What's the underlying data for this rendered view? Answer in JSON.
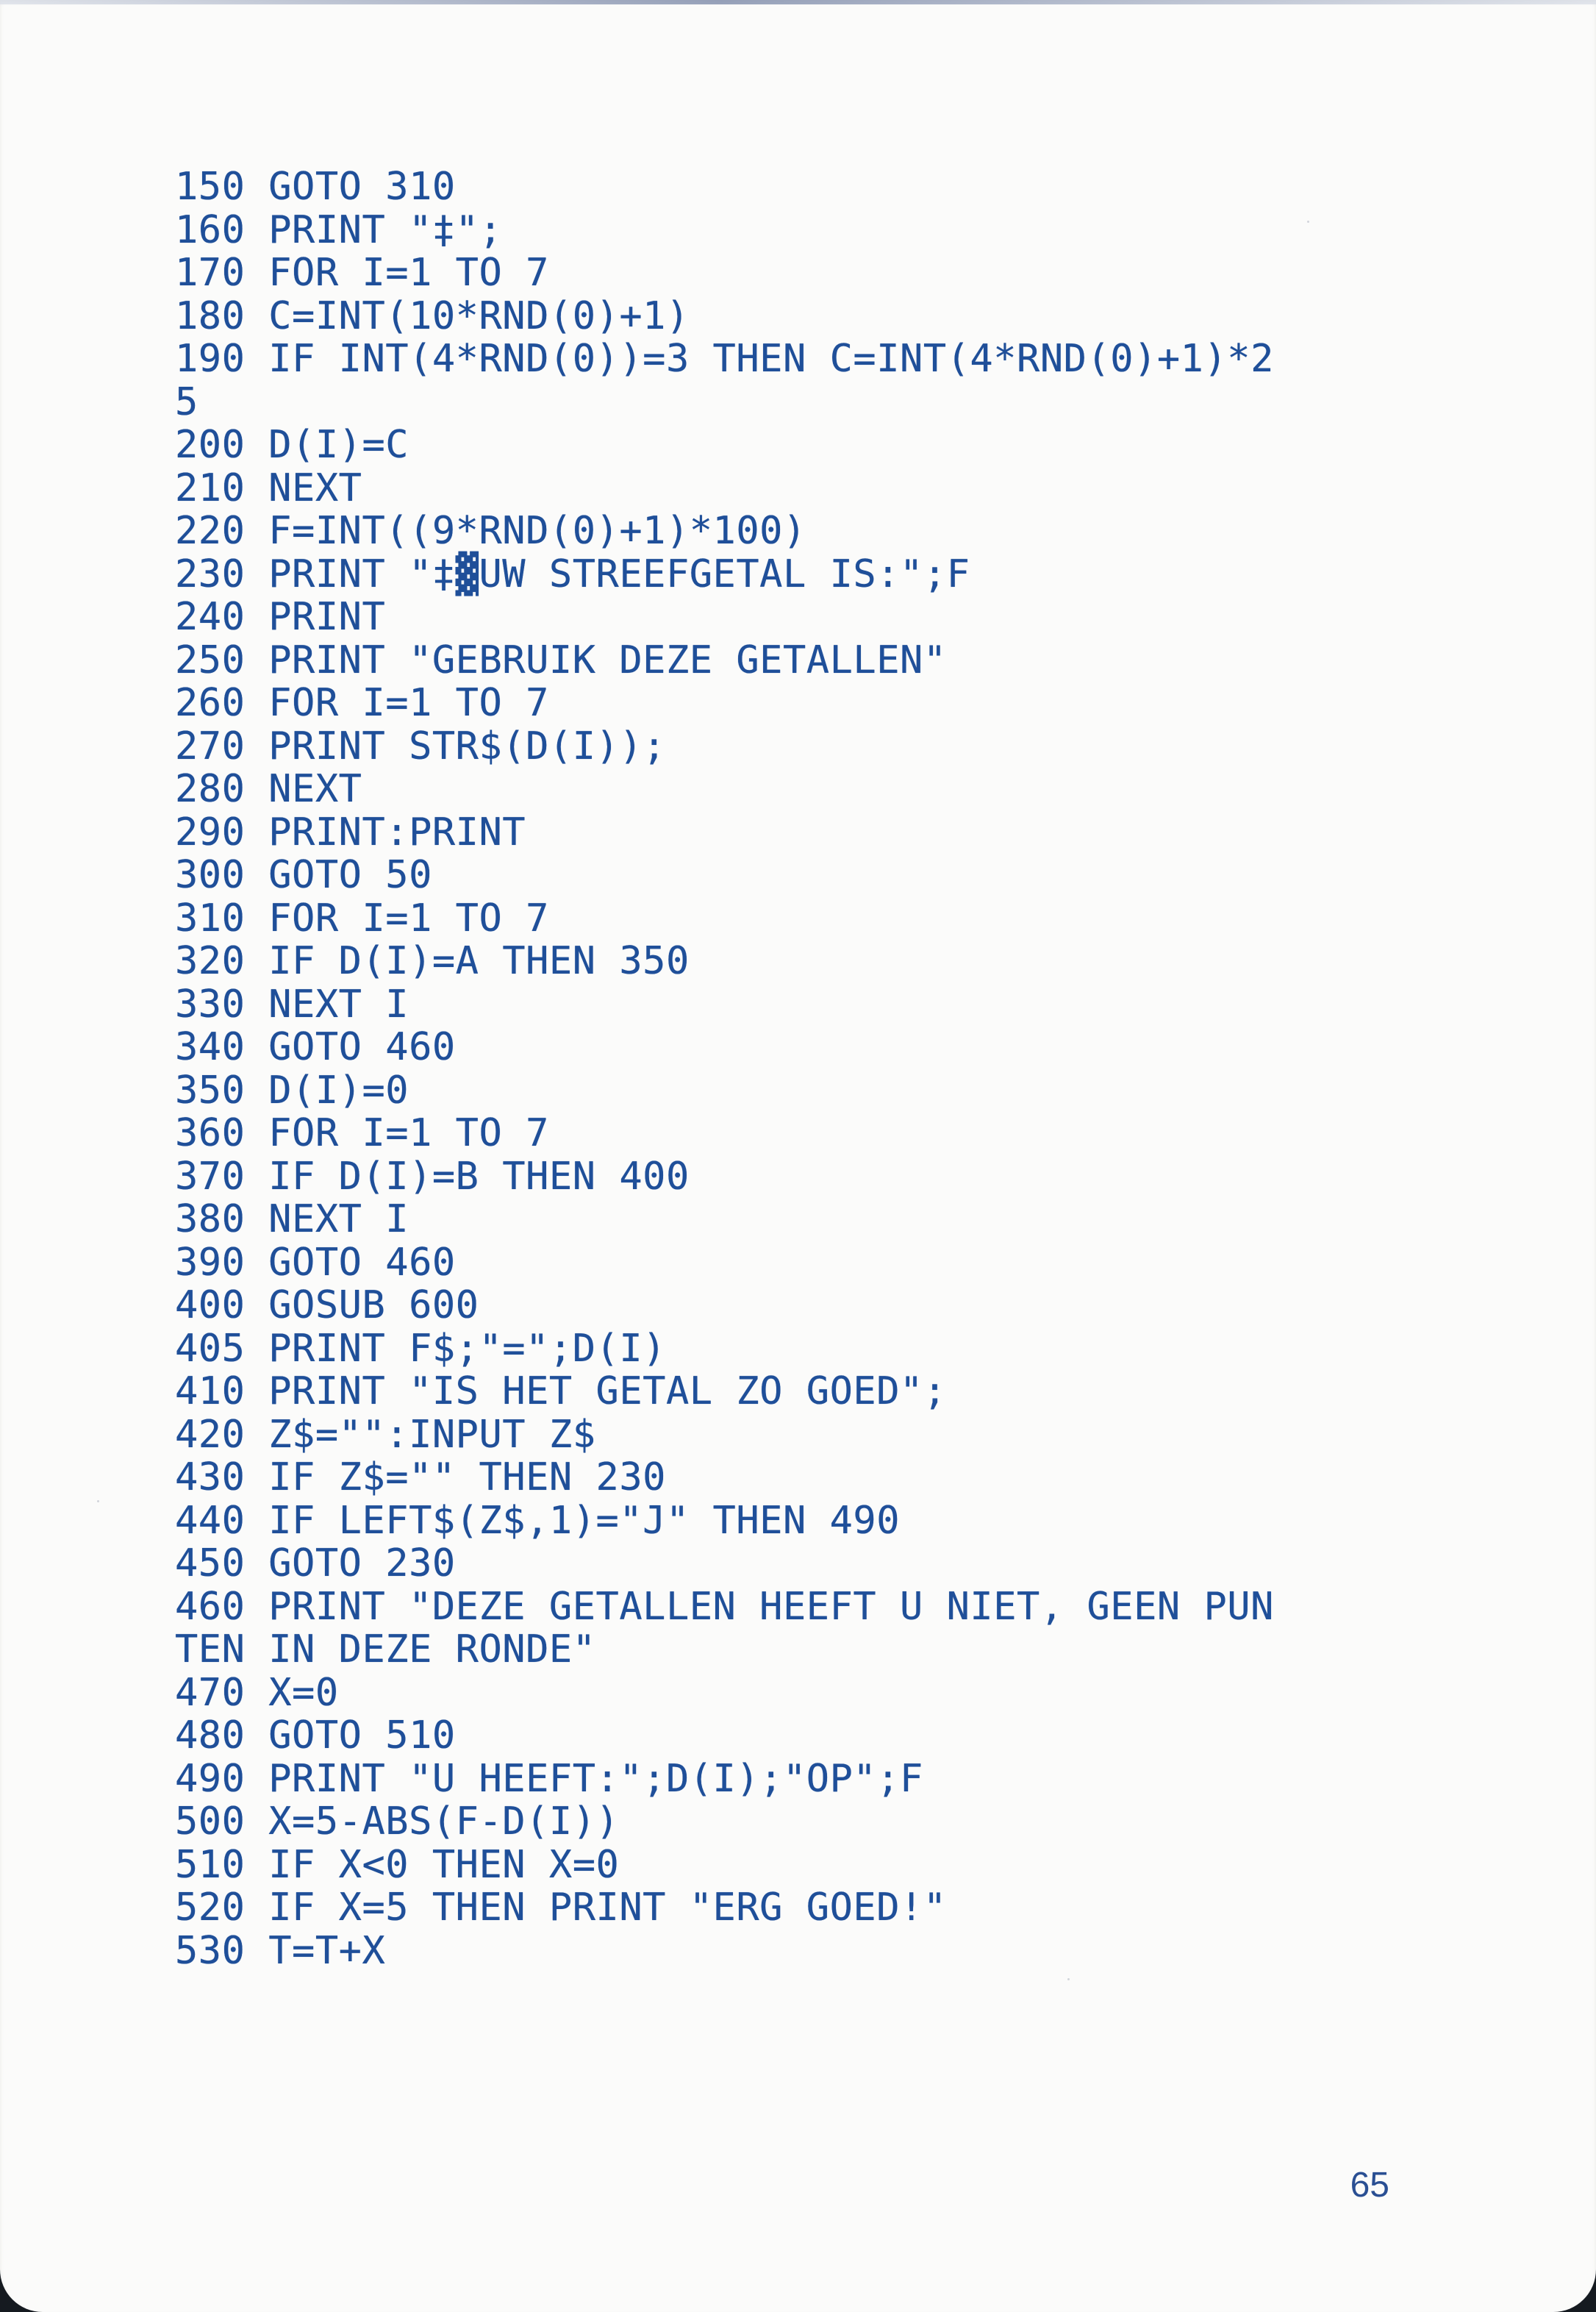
{
  "listing": {
    "lines": [
      "150 GOTO 310",
      "160 PRINT \"‡\";",
      "170 FOR I=1 TO 7",
      "180 C=INT(10*RND(0)+1)",
      "190 IF INT(4*RND(0))=3 THEN C=INT(4*RND(0)+1)*2",
      "5",
      "200 D(I)=C",
      "210 NEXT",
      "220 F=INT((9*RND(0)+1)*100)",
      "230 PRINT \"‡▓UW STREEFGETAL IS:\";F",
      "240 PRINT",
      "250 PRINT \"GEBRUIK DEZE GETALLEN\"",
      "260 FOR I=1 TO 7",
      "270 PRINT STR$(D(I));",
      "280 NEXT",
      "290 PRINT:PRINT",
      "300 GOTO 50",
      "310 FOR I=1 TO 7",
      "320 IF D(I)=A THEN 350",
      "330 NEXT I",
      "340 GOTO 460",
      "350 D(I)=0",
      "360 FOR I=1 TO 7",
      "370 IF D(I)=B THEN 400",
      "380 NEXT I",
      "390 GOTO 460",
      "400 GOSUB 600",
      "405 PRINT F$;\"=\";D(I)",
      "410 PRINT \"IS HET GETAL ZO GOED\";",
      "420 Z$=\"\":INPUT Z$",
      "430 IF Z$=\"\" THEN 230",
      "440 IF LEFT$(Z$,1)=\"J\" THEN 490",
      "450 GOTO 230",
      "460 PRINT \"DEZE GETALLEN HEEFT U NIET, GEEN PUN",
      "TEN IN DEZE RONDE\"",
      "470 X=0",
      "480 GOTO 510",
      "490 PRINT \"U HEEFT:\";D(I);\"OP\";F",
      "500 X=5-ABS(F-D(I))",
      "510 IF X<0 THEN X=0",
      "520 IF X=5 THEN PRINT \"ERG GOED!\"",
      "530 T=T+X"
    ]
  },
  "page_number": "65"
}
